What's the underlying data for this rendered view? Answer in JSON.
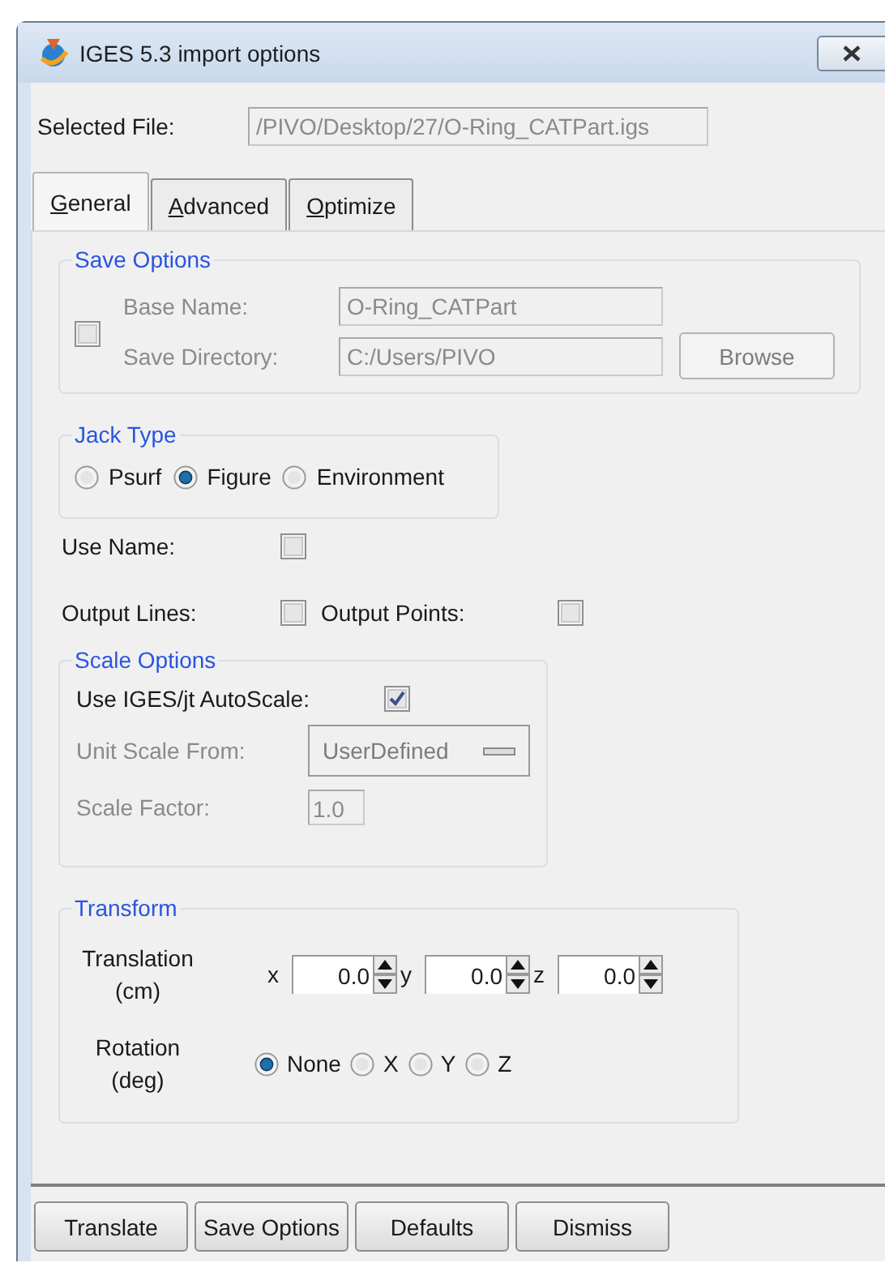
{
  "window": {
    "title": "IGES 5.3 import options"
  },
  "selected_file": {
    "label": "Selected File:",
    "value": "/PIVO/Desktop/27/O-Ring_CATPart.igs"
  },
  "tabs": [
    {
      "label": "General",
      "selected": true
    },
    {
      "label": "Advanced",
      "selected": false
    },
    {
      "label": "Optimize",
      "selected": false
    }
  ],
  "save_options": {
    "title": "Save Options",
    "checked": false,
    "fields": [
      {
        "label": "Base Name:",
        "value": "O-Ring_CATPart",
        "disabled": true
      },
      {
        "label": "Save Directory:",
        "value": "C:/Users/PIVO",
        "disabled": true
      }
    ],
    "browse_button": {
      "label": "Browse",
      "disabled": true
    }
  },
  "jack_type": {
    "title": "Jack Type",
    "options": [
      {
        "label": "Psurf",
        "selected": false
      },
      {
        "label": "Figure",
        "selected": true
      },
      {
        "label": "Environment",
        "selected": false
      }
    ]
  },
  "use_name": {
    "label": "Use Name:",
    "checked": false
  },
  "output_lines": {
    "label": "Output Lines:",
    "checked": false
  },
  "output_points": {
    "label": "Output Points:",
    "checked": false
  },
  "scale_options": {
    "title": "Scale Options",
    "autoscale": {
      "label": "Use IGES/jt AutoScale:",
      "checked": true
    },
    "unit_scale_from": {
      "label": "Unit Scale From:",
      "value": "UserDefined",
      "disabled": true
    },
    "scale_factor": {
      "label": "Scale Factor:",
      "value": "1.0",
      "disabled": true
    }
  },
  "transform": {
    "title": "Transform",
    "translation": {
      "label": "Translation",
      "unit": "(cm)",
      "axes": [
        {
          "label": "x",
          "value": "0.0"
        },
        {
          "label": "y",
          "value": "0.0"
        },
        {
          "label": "z",
          "value": "0.0"
        }
      ]
    },
    "rotation": {
      "label": "Rotation",
      "unit": "(deg)",
      "options": [
        {
          "label": "None",
          "selected": true
        },
        {
          "label": "X",
          "selected": false
        },
        {
          "label": "Y",
          "selected": false
        },
        {
          "label": "Z",
          "selected": false
        }
      ]
    }
  },
  "buttons": [
    "Translate",
    "Save Options",
    "Defaults",
    "Dismiss"
  ]
}
